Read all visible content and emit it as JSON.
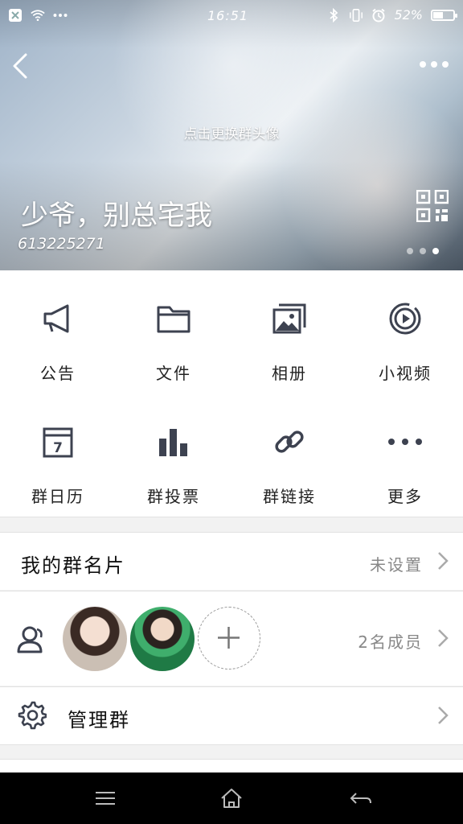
{
  "status_bar": {
    "time": "16:51",
    "battery_percent": "52%",
    "battery_level": 0.52
  },
  "header": {
    "change_avatar_text": "点击更换群头像",
    "group_name": "少爷，别总宅我",
    "group_id": "613225271",
    "page_indicator": {
      "count": 3,
      "active": 2
    }
  },
  "features": [
    {
      "label": "公告",
      "icon": "megaphone-icon"
    },
    {
      "label": "文件",
      "icon": "folder-icon"
    },
    {
      "label": "相册",
      "icon": "photo-album-icon"
    },
    {
      "label": "小视频",
      "icon": "video-play-icon"
    },
    {
      "label": "群日历",
      "icon": "calendar-icon",
      "calendar_day": "7"
    },
    {
      "label": "群投票",
      "icon": "bar-chart-icon"
    },
    {
      "label": "群链接",
      "icon": "link-icon"
    },
    {
      "label": "更多",
      "icon": "more-dots-icon"
    }
  ],
  "my_card": {
    "title": "我的群名片",
    "value": "未设置"
  },
  "members": {
    "value": "2名成员"
  },
  "manage": {
    "title": "管理群"
  },
  "colors": {
    "icon": "#3d4250",
    "accent_gray": "#888888",
    "nav_bg": "#000000"
  }
}
